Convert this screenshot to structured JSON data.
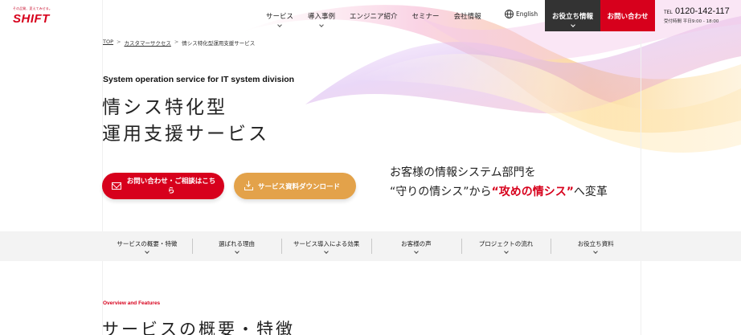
{
  "header": {
    "logo_tagline": "その品質、変えてみせる。",
    "logo_text": "SHIFT",
    "nav": [
      {
        "label": "サービス",
        "has_dropdown": true
      },
      {
        "label": "導入事例",
        "has_dropdown": true
      },
      {
        "label": "エンジニア紹介",
        "has_dropdown": false
      },
      {
        "label": "セミナー",
        "has_dropdown": false
      },
      {
        "label": "会社情報",
        "has_dropdown": false
      }
    ],
    "language_label": "English",
    "useful_info_label": "お役立ち情報",
    "contact_label": "お問い合わせ",
    "tel_prefix": "TEL",
    "tel_number": "0120-142-117",
    "tel_hours": "受付時間 平日9:00 - 18:00"
  },
  "breadcrumb": [
    "TOP",
    "カスタマーサクセス",
    "情シス特化型運用支援サービス"
  ],
  "hero": {
    "eyebrow": "System operation service for IT system division",
    "title_line1": "情シス特化型",
    "title_line2": "運用支援サービス",
    "cta_contact": "お問い合わせ・ご相談はこちら",
    "cta_download": "サービス資料ダウンロード",
    "tagline_line1": "お客様の情報システム部門を",
    "tagline_part1": "“守りの情シス”から",
    "tagline_highlight": "“攻めの情シス”",
    "tagline_part2": "へ変革"
  },
  "subnav": [
    "サービスの概要・特徴",
    "選ばれる理由",
    "サービス導入による効果",
    "お客様の声",
    "プロジェクトの流れ",
    "お役立ち資料"
  ],
  "section": {
    "eyebrow": "Overview and Features",
    "title": "サービスの概要・特徴"
  },
  "colors": {
    "brand_red": "#d7001c",
    "dark": "#333333",
    "download_orange": "#e3a24a",
    "subnav_bg": "#f3f3f3"
  }
}
